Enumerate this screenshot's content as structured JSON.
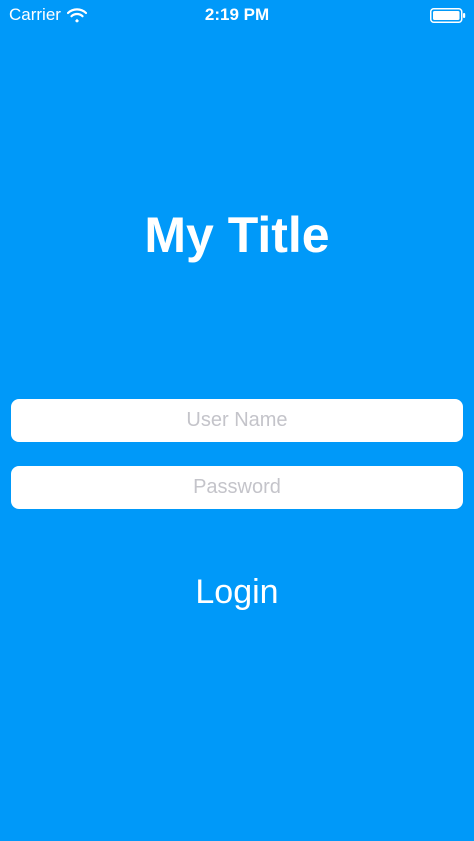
{
  "status_bar": {
    "carrier": "Carrier",
    "time": "2:19 PM",
    "wifi_icon": "wifi-icon",
    "battery_icon": "battery-icon"
  },
  "screen": {
    "title": "My Title",
    "background_color": "#0099f9"
  },
  "form": {
    "username_placeholder": "User Name",
    "username_value": "",
    "password_placeholder": "Password",
    "password_value": "",
    "login_label": "Login"
  }
}
